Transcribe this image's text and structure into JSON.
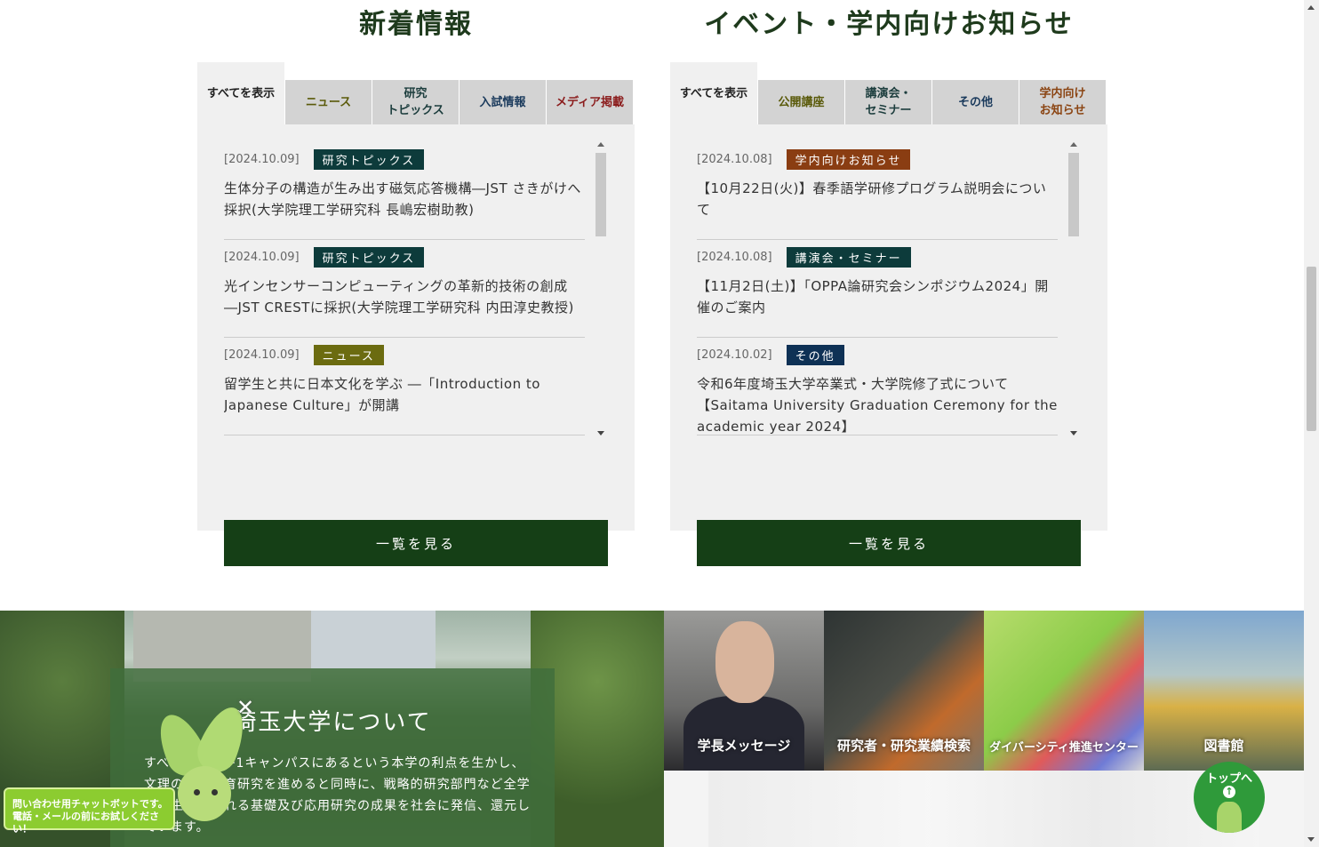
{
  "news": {
    "title": "新着情報",
    "tabs": [
      {
        "label": "すべてを表示",
        "color": "#222222"
      },
      {
        "label": "ニュース",
        "color": "#5a5a0a"
      },
      {
        "label": "研究\nトピックス",
        "color": "#1c3d3d"
      },
      {
        "label": "入試情報",
        "color": "#1a3a5c"
      },
      {
        "label": "メディア掲載",
        "color": "#8b1c1c"
      }
    ],
    "items": [
      {
        "date": "[2024.10.09]",
        "badge": "研究トピックス",
        "badge_color": "#0d3b3b",
        "text": "生体分子の構造が生み出す磁気応答機構―JST さきがけへ採択(大学院理工学研究科 長嶋宏樹助教)"
      },
      {
        "date": "[2024.10.09]",
        "badge": "研究トピックス",
        "badge_color": "#0d3b3b",
        "text": "光インセンサーコンピューティングの革新的技術の創成―JST CRESTに採択(大学院理工学研究科 内田淳史教授)"
      },
      {
        "date": "[2024.10.09]",
        "badge": "ニュース",
        "badge_color": "#6b6b10",
        "text": "留学生と共に日本文化を学ぶ ―「Introduction to Japanese Culture」が開講"
      }
    ],
    "more_label": "一覧を見る"
  },
  "events": {
    "title": "イベント・学内向けお知らせ",
    "tabs": [
      {
        "label": "すべてを表示",
        "color": "#222222"
      },
      {
        "label": "公開講座",
        "color": "#5a5a0a"
      },
      {
        "label": "講演会・\nセミナー",
        "color": "#1c3d3d"
      },
      {
        "label": "その他",
        "color": "#1a3a5c"
      },
      {
        "label": "学内向け\nお知らせ",
        "color": "#8b4513"
      }
    ],
    "items": [
      {
        "date": "[2024.10.08]",
        "badge": "学内向けお知らせ",
        "badge_color": "#8a3d12",
        "text": "【10月22日(火)】春季語学研修プログラム説明会について"
      },
      {
        "date": "[2024.10.08]",
        "badge": "講演会・セミナー",
        "badge_color": "#0d3b3b",
        "text": "【11月2日(土)】「OPPA論研究会シンポジウム2024」開催のご案内"
      },
      {
        "date": "[2024.10.02]",
        "badge": "その他",
        "badge_color": "#0e3155",
        "text": "令和6年度埼玉大学卒業式・大学院修了式について【Saitama University Graduation Ceremony for the academic year 2024】"
      }
    ],
    "more_label": "一覧を見る"
  },
  "about": {
    "title": "埼玉大学について",
    "text": "すべての学部が1キャンパスにあるという本学の利点を生かし、文理の融合教育研究を進めると同時に、戦略的研究部門など全学から生み出される基礎及び応用研究の成果を社会に発信、還元しています。"
  },
  "tiles": [
    {
      "label": "学長メッセージ"
    },
    {
      "label": "研究者・研究業績検索"
    },
    {
      "label": "ダイバーシティ推進センター"
    },
    {
      "label": "図書館"
    }
  ],
  "chatbot": {
    "text": "問い合わせ用チャットボットです。\n電話・メールの前にお試しください！"
  },
  "to_top": {
    "label": "トップへ",
    "icon": "arrow-up-icon"
  }
}
